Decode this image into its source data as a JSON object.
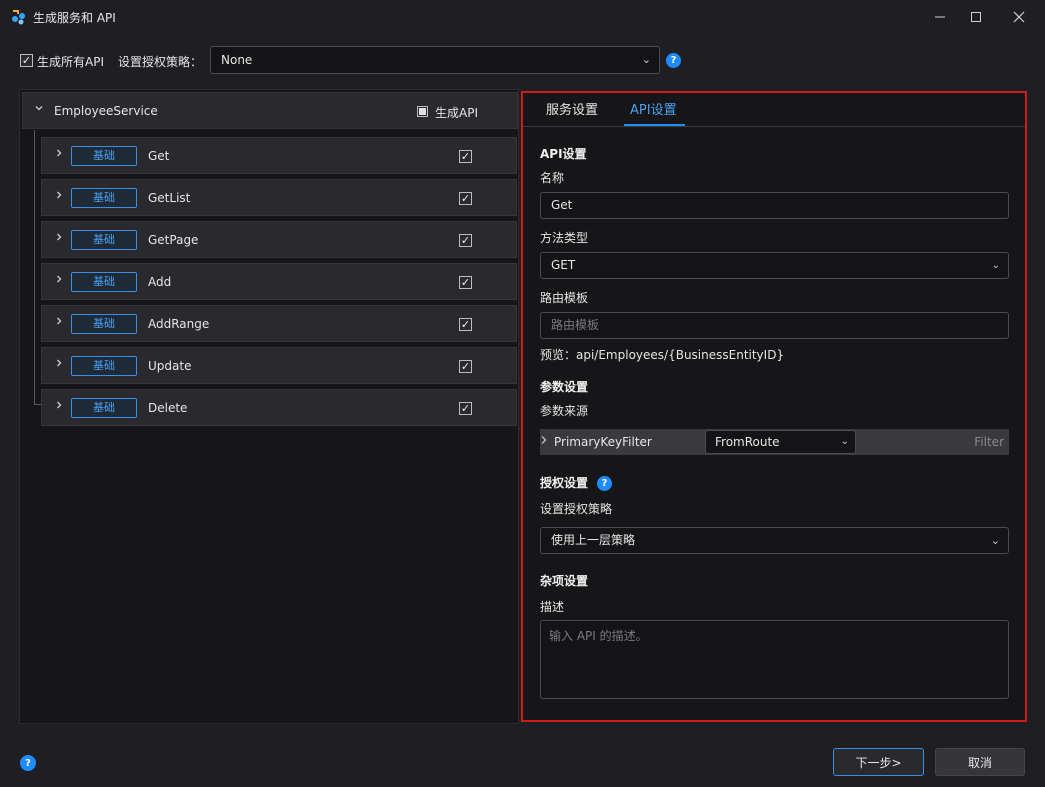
{
  "window": {
    "title": "生成服务和 API",
    "controls": {
      "minimize": "—",
      "maximize": "☐",
      "close": "✕"
    }
  },
  "top": {
    "gen_all_checked": true,
    "gen_all_label": "生成所有API",
    "policy_label": "设置授权策略：",
    "policy_value": "None"
  },
  "tree": {
    "service": {
      "name": "EmployeeService",
      "gen_api_label": "生成API",
      "gen_api_state": "indeterminate"
    },
    "apis": [
      {
        "badge": "基础",
        "name": "Get",
        "checked": true
      },
      {
        "badge": "基础",
        "name": "GetList",
        "checked": true
      },
      {
        "badge": "基础",
        "name": "GetPage",
        "checked": true
      },
      {
        "badge": "基础",
        "name": "Add",
        "checked": true
      },
      {
        "badge": "基础",
        "name": "AddRange",
        "checked": true
      },
      {
        "badge": "基础",
        "name": "Update",
        "checked": true
      },
      {
        "badge": "基础",
        "name": "Delete",
        "checked": true
      }
    ]
  },
  "tabs": {
    "service": "服务设置",
    "api": "API设置",
    "active": "api"
  },
  "api_settings": {
    "section_title": "API设置",
    "name_label": "名称",
    "name_value": "Get",
    "method_label": "方法类型",
    "method_value": "GET",
    "route_label": "路由模板",
    "route_placeholder": "路由模板",
    "preview": "预览：api/Employees/{BusinessEntityID}"
  },
  "param_settings": {
    "section_title": "参数设置",
    "source_label": "参数来源",
    "row": {
      "name": "PrimaryKeyFilter",
      "source": "FromRoute",
      "type": "Filter"
    }
  },
  "auth_settings": {
    "section_title": "授权设置",
    "policy_label": "设置授权策略",
    "policy_value": "使用上一层策略"
  },
  "misc_settings": {
    "section_title": "杂项设置",
    "desc_label": "描述",
    "desc_placeholder": "输入 API 的描述。"
  },
  "footer": {
    "next_label": "下一步>",
    "cancel_label": "取消"
  },
  "colors": {
    "accent": "#1e8cff",
    "highlight_border": "#d11a1a",
    "badge": "#4aa0f0"
  }
}
